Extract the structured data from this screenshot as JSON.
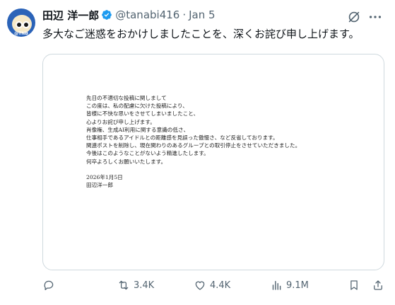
{
  "author": {
    "name": "田辺 洋一郎",
    "handle": "@tanabi416",
    "separator": "·",
    "date": "Jan 5",
    "avatar_tag": "@TNB"
  },
  "tweet_text": "多大なご迷惑をおかけしましたことを、深くお詫び申し上げます。",
  "letter": {
    "lines": [
      "先日の不適切な投稿に関しまして",
      "この度は、私の配慮に欠けた投稿により、",
      "皆様に不快な思いをさせてしまいましたこと、",
      "心よりお詫び申し上げます。",
      "肖像権、生成AI利用に関する意識の低さ、",
      "仕事相手であるアイドルとの距離感を見誤った傲慢さ、など反省しております。",
      "関連ポストを削除し、現在関わりのあるグループとの取引停止をさせていただきました。",
      "今後はこのようなことがないよう精進したします。",
      "何卒よろしくお願いいたします。"
    ],
    "date": "2026年1月5日",
    "signature": "田辺洋一郎"
  },
  "actions": {
    "reply": "",
    "retweets": "3.4K",
    "likes": "4.4K",
    "views": "9.1M"
  },
  "icons": [
    "verified-badge-icon",
    "grok-icon",
    "more-icon",
    "reply-icon",
    "retweet-icon",
    "like-icon",
    "views-icon",
    "bookmark-icon",
    "share-icon"
  ],
  "colors": {
    "text": "#0f1419",
    "secondary": "#536471",
    "verified": "#1d9bf0",
    "border": "#cfd9de"
  }
}
